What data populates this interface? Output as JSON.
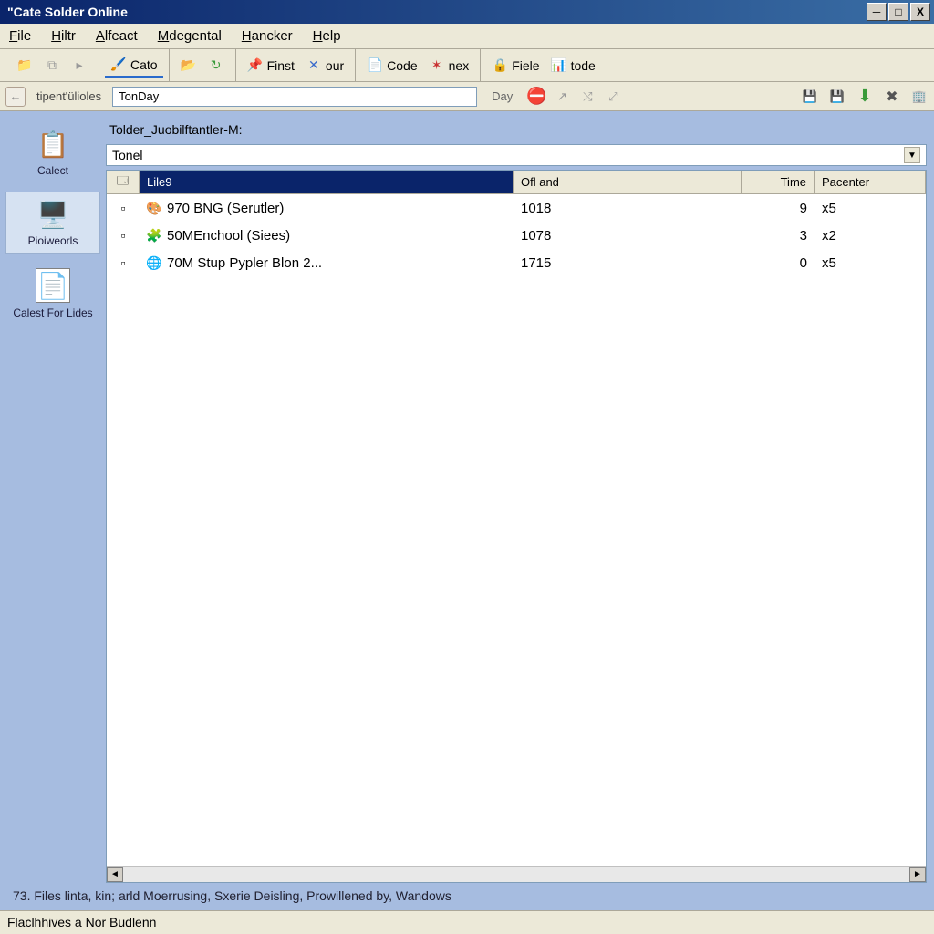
{
  "window": {
    "title": "\"Cate Solder Online"
  },
  "menu": {
    "file": "File",
    "hiltr": "Hiltr",
    "alfeact": "Alfeact",
    "mdegental": "Mdegental",
    "hancker": "Hancker",
    "help": "Help"
  },
  "toolbar": {
    "cato": "Cato",
    "finst": "Finst",
    "our": "our",
    "code": "Code",
    "nex": "nex",
    "fiele": "Fiele",
    "tode": "tode"
  },
  "address": {
    "label": "tipent'ülioles",
    "value": "TonDay",
    "day_label": "Day"
  },
  "sidebar": {
    "calect": "Calect",
    "pioweorls": "Pioiweorls",
    "calest_for_lides": "Calest For Lides"
  },
  "main": {
    "path": "Tolder_Juobilftantler-M:",
    "combo_value": "Tonel",
    "columns": {
      "c1": "Lile9",
      "c2": "Ofl and",
      "c3": "Time",
      "c4": "Pacenter"
    },
    "rows": [
      {
        "name": "970 BNG (Serutler)",
        "ofl": "1018",
        "time": "9",
        "pac": "x5"
      },
      {
        "name": "50MEnchool (Siees)",
        "ofl": "1078",
        "time": "3",
        "pac": "x2"
      },
      {
        "name": "70M Stup Pypler Blon 2...",
        "ofl": "1715",
        "time": "0",
        "pac": "x5"
      }
    ]
  },
  "status": {
    "line1": "73. Files linta, kin; arld Moerrusing, Sxerie Deisling, Prowillened by, Wandows",
    "line2": "Flaclhhives a Nor Budlenn"
  }
}
